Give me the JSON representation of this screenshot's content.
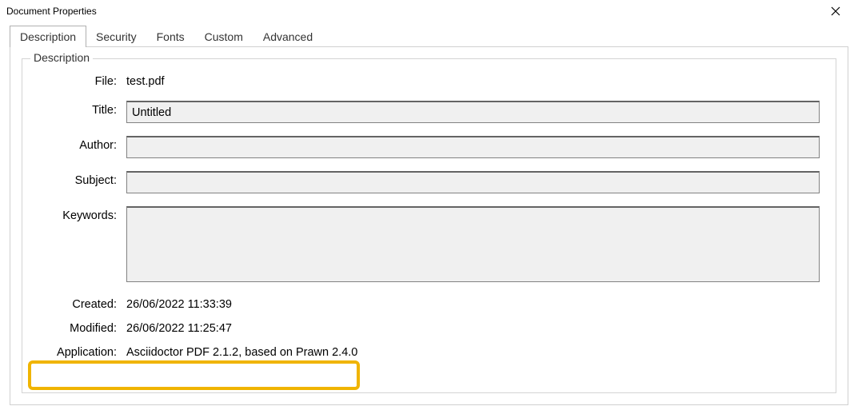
{
  "window": {
    "title": "Document Properties"
  },
  "tabs": {
    "description": "Description",
    "security": "Security",
    "fonts": "Fonts",
    "custom": "Custom",
    "advanced": "Advanced"
  },
  "fieldset": {
    "legend": "Description"
  },
  "labels": {
    "file": "File:",
    "title": "Title:",
    "author": "Author:",
    "subject": "Subject:",
    "keywords": "Keywords:",
    "created": "Created:",
    "modified": "Modified:",
    "application": "Application:"
  },
  "values": {
    "file": "test.pdf",
    "title": "Untitled",
    "author": "",
    "subject": "",
    "keywords": "",
    "created": "26/06/2022 11:33:39",
    "modified": "26/06/2022 11:25:47",
    "application": "Asciidoctor PDF 2.1.2, based on Prawn 2.4.0"
  }
}
